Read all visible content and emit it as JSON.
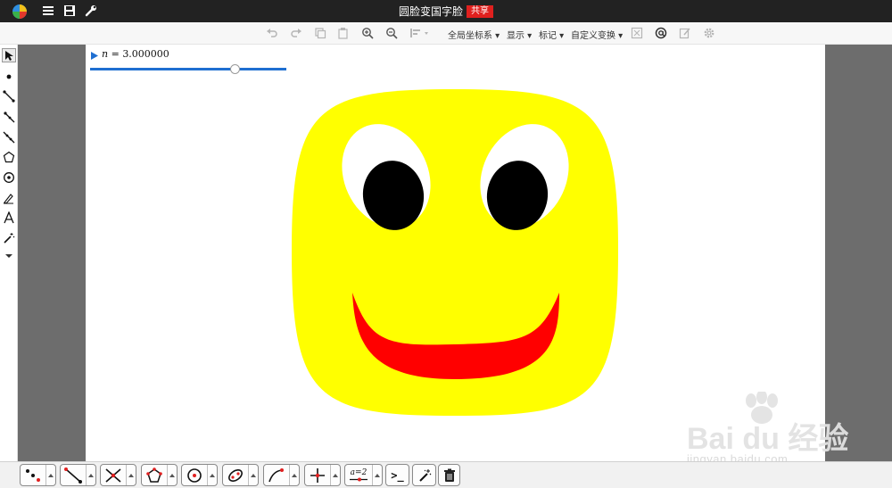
{
  "header": {
    "document_title": "圆脸变国字脸",
    "share_label": "共享"
  },
  "toolbar": {
    "menus": {
      "global_axes": "全局坐标系 ▾",
      "display": "显示 ▾",
      "mark": "标记 ▾",
      "custom_transform": "自定义变换 ▾"
    }
  },
  "slider": {
    "variable": "n",
    "equals": " = ",
    "value": "3.000000",
    "fraction": 0.74
  },
  "bottom_tools": {
    "expression_label": "a=2",
    "command_label": ">_"
  },
  "watermark": {
    "brand": "Bai du 经验",
    "url": "jingyan.baidu.com"
  },
  "colors": {
    "face": "#ffff00",
    "eye_white": "#ffffff",
    "pupil": "#000000",
    "mouth": "#ff0000",
    "share": "#e0201e",
    "slider": "#1f6fd1"
  }
}
